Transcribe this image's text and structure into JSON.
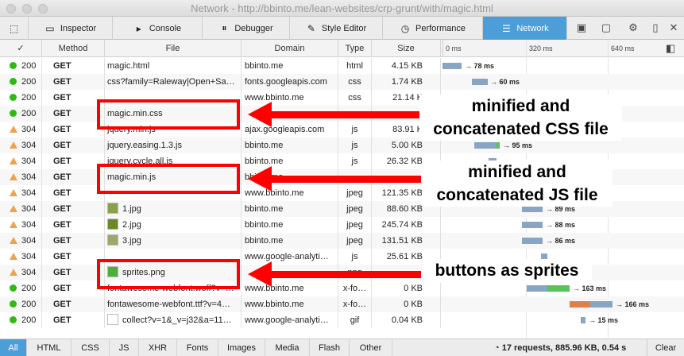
{
  "window": {
    "title": "Network - http://bbinto.me/lean-websites/crp-grunt/with/magic.html"
  },
  "toolbar": {
    "tabs": [
      {
        "label": "Inspector",
        "icon": "inspector-icon"
      },
      {
        "label": "Console",
        "icon": "console-icon"
      },
      {
        "label": "Debugger",
        "icon": "debugger-icon"
      },
      {
        "label": "Style Editor",
        "icon": "style-editor-icon"
      },
      {
        "label": "Performance",
        "icon": "performance-icon"
      },
      {
        "label": "Network",
        "icon": "network-icon",
        "active": true
      }
    ],
    "accent": "#4c9ed9"
  },
  "columns": {
    "check": "✓",
    "method": "Method",
    "file": "File",
    "domain": "Domain",
    "type": "Type",
    "size": "Size"
  },
  "timeline_ticks": [
    "0 ms",
    "320 ms",
    "640 ms"
  ],
  "requests": [
    {
      "status": "200",
      "method": "GET",
      "file": "magic.html",
      "domain": "bbinto.me",
      "type": "html",
      "size": "4.15 KB",
      "timing": "→ 78 ms",
      "cached": false
    },
    {
      "status": "200",
      "method": "GET",
      "file": "css?family=Raleway|Open+Sa…",
      "domain": "fonts.googleapis.com",
      "type": "css",
      "size": "1.74 KB",
      "timing": "→ 60 ms",
      "cached": false
    },
    {
      "status": "200",
      "method": "GET",
      "file": "",
      "domain": "www.bbinto.me",
      "type": "css",
      "size": "21.14 K",
      "timing": "",
      "cached": false
    },
    {
      "status": "200",
      "method": "GET",
      "file": "magic.min.css",
      "domain": "",
      "type": "",
      "size": "",
      "timing": "",
      "cached": false
    },
    {
      "status": "304",
      "method": "GET",
      "file": "jquery.min.js",
      "domain": "ajax.googleapis.com",
      "type": "js",
      "size": "83.91 K",
      "timing": "",
      "cached": true
    },
    {
      "status": "304",
      "method": "GET",
      "file": "jquery.easing.1.3.js",
      "domain": "bbinto.me",
      "type": "js",
      "size": "5.00 KB",
      "timing": "→ 95 ms",
      "cached": true
    },
    {
      "status": "304",
      "method": "GET",
      "file": "jquery.cycle.all.js",
      "domain": "bbinto.me",
      "type": "js",
      "size": "26.32 KB",
      "timing": "",
      "cached": true
    },
    {
      "status": "304",
      "method": "GET",
      "file": "magic.min.js",
      "domain": "bbinto.me",
      "type": "",
      "size": "",
      "timing": "",
      "cached": true
    },
    {
      "status": "304",
      "method": "GET",
      "file": "",
      "domain": "www.bbinto.me",
      "type": "jpeg",
      "size": "121.35 KB",
      "timing": "",
      "cached": true
    },
    {
      "status": "304",
      "method": "GET",
      "file": "1.jpg",
      "domain": "bbinto.me",
      "type": "jpeg",
      "size": "88.60 KB",
      "timing": "→ 89 ms",
      "cached": true,
      "thumb": "#8aa04a"
    },
    {
      "status": "304",
      "method": "GET",
      "file": "2.jpg",
      "domain": "bbinto.me",
      "type": "jpeg",
      "size": "245.74 KB",
      "timing": "→ 88 ms",
      "cached": true,
      "thumb": "#6a8a2a"
    },
    {
      "status": "304",
      "method": "GET",
      "file": "3.jpg",
      "domain": "bbinto.me",
      "type": "jpeg",
      "size": "131.51 KB",
      "timing": "→ 86 ms",
      "cached": true,
      "thumb": "#9aa86a"
    },
    {
      "status": "304",
      "method": "GET",
      "file": "",
      "domain": "www.google-analyti…",
      "type": "js",
      "size": "25.61 KB",
      "timing": "",
      "cached": true
    },
    {
      "status": "304",
      "method": "GET",
      "file": "sprites.png",
      "domain": "",
      "type": "png",
      "size": "",
      "timing": "",
      "cached": true
    },
    {
      "status": "200",
      "method": "GET",
      "file": "fontawesome-webfont.woff?v=…",
      "domain": "www.bbinto.me",
      "type": "x-fo…",
      "size": "0 KB",
      "timing": "→ 163 ms",
      "cached": false
    },
    {
      "status": "200",
      "method": "GET",
      "file": "fontawesome-webfont.ttf?v=4…",
      "domain": "www.bbinto.me",
      "type": "x-fo…",
      "size": "0 KB",
      "timing": "→ 166 ms",
      "cached": false
    },
    {
      "status": "200",
      "method": "GET",
      "file": "collect?v=1&_v=j32&a=11…",
      "domain": "www.google-analyti…",
      "type": "gif",
      "size": "0.04 KB",
      "timing": "→ 15 ms",
      "cached": false
    }
  ],
  "annotations": {
    "css": [
      "minified and",
      "concatenated CSS file"
    ],
    "js": [
      "minified and",
      "concatenated JS file"
    ],
    "sprites": [
      "buttons as sprites"
    ],
    "color": "#ff0000"
  },
  "filters": [
    "All",
    "HTML",
    "CSS",
    "JS",
    "XHR",
    "Fonts",
    "Images",
    "Media",
    "Flash",
    "Other"
  ],
  "summary": "17 requests, 885.96 KB, 0.54 s",
  "clear_label": "Clear",
  "status_colors": {
    "ok": "#2cbb0f",
    "not_modified": "#f0a24b"
  }
}
